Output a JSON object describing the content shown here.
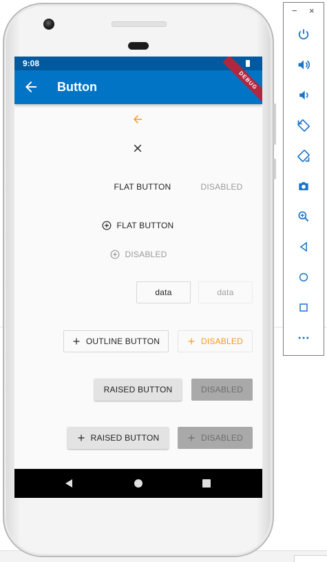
{
  "status_bar": {
    "time": "9:08"
  },
  "app_bar": {
    "title": "Button",
    "debug_label": "DEBUG"
  },
  "buttons": {
    "flat_label": "FLAT BUTTON",
    "flat_disabled_label": "DISABLED",
    "flat_icon_label": "FLAT BUTTON",
    "flat_icon_disabled_label": "DISABLED",
    "data_label": "data",
    "data_disabled_label": "data",
    "outline_label": "OUTLINE BUTTON",
    "outline_disabled_label": "DISABLED",
    "raised_label": "RAISED BUTTON",
    "raised_disabled_label": "DISABLED",
    "raised_icon_label": "RAISED BUTTON",
    "raised_icon_disabled_label": "DISABLED"
  },
  "icons": {
    "orange_back": "arrow-back-icon",
    "close": "close-icon",
    "add_circle": "add-circle-outline-icon",
    "add": "add-icon"
  },
  "colors": {
    "status_bar": "#015a9f",
    "app_bar": "#0174c6",
    "accent_orange": "#f39a1c",
    "debug_banner": "#b0283f",
    "screen_background": "#fafafa"
  },
  "emulator_toolbar": {
    "minimize": "−",
    "close": "×",
    "items": [
      "power-icon",
      "volume-up-icon",
      "volume-down-icon",
      "rotate-left-icon",
      "rotate-right-icon",
      "camera-icon",
      "zoom-icon",
      "back-icon",
      "home-icon",
      "overview-icon",
      "more-icon"
    ]
  }
}
